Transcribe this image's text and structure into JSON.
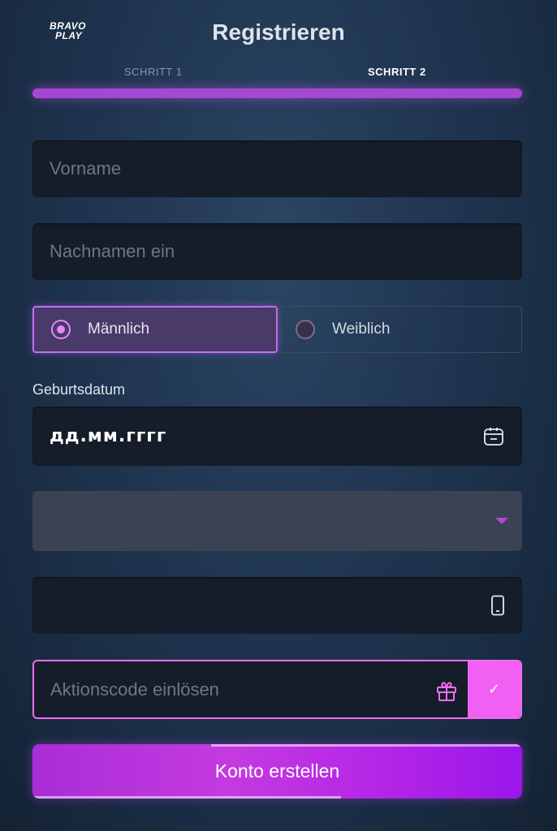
{
  "header": {
    "logo_line1": "BRAVO",
    "logo_line2": "PLAY",
    "title": "Registrieren"
  },
  "steps": [
    {
      "label": "SCHRITT 1",
      "active": false
    },
    {
      "label": "SCHRITT 2",
      "active": true
    }
  ],
  "progress": {
    "fraction": 1.0
  },
  "form": {
    "first_name": {
      "placeholder": "Vorname",
      "value": ""
    },
    "last_name": {
      "placeholder": "Nachnamen ein",
      "value": ""
    },
    "gender": {
      "options": [
        {
          "label": "Männlich",
          "selected": true
        },
        {
          "label": "Weiblich",
          "selected": false
        }
      ]
    },
    "birthdate": {
      "label": "Geburtsdatum",
      "value": "дд.мм.гггг"
    },
    "country_select": {
      "value": ""
    },
    "phone": {
      "value": ""
    },
    "promo": {
      "placeholder": "Aktionscode einlösen",
      "confirm_glyph": "✓"
    },
    "submit_label": "Konto erstellen"
  },
  "colors": {
    "accent": "#c46cf0",
    "promo_border": "#f06cf0",
    "submit": "#b527e6",
    "field_bg": "#161d2a"
  },
  "icons": [
    "calendar-icon",
    "chevron-down-icon",
    "phone-icon",
    "gift-icon",
    "check-icon"
  ]
}
